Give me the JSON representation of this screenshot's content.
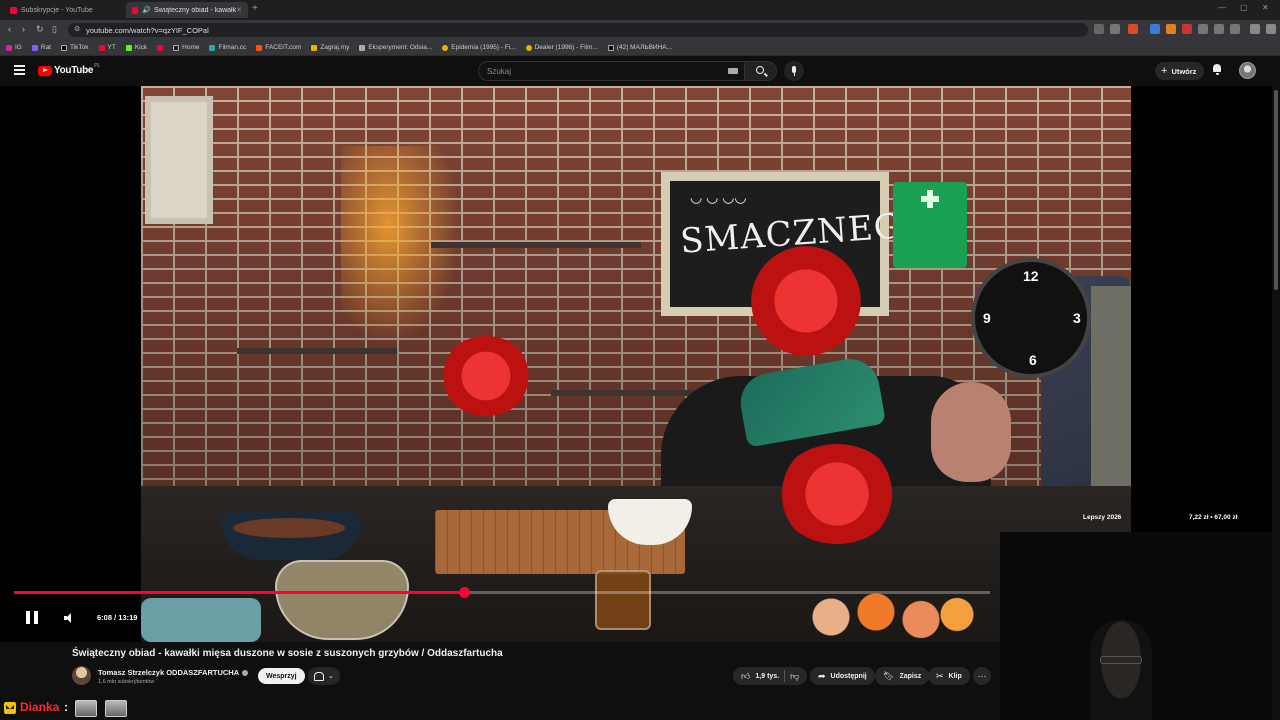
{
  "browser": {
    "tabs": [
      {
        "label": "Subskrypcje - YouTube",
        "active": false
      },
      {
        "label": "Świąteczny obiad - kawałki m",
        "active": true
      }
    ],
    "url": "youtube.com/watch?v=qzYIF_COPal",
    "bookmarks": [
      "IG",
      "Rat",
      "TikTok",
      "YT",
      "Kick",
      "Home",
      "Filman.cc",
      "FACEIT.com",
      "Zagraj.my",
      "Eksperyment: Odsia...",
      "Epidemia (1995) - Fi...",
      "Dealer (1996) - Film...",
      "(42) МАЛЬВИНА..."
    ]
  },
  "youtube": {
    "logo_text": "YouTube",
    "region": "PL",
    "search_placeholder": "Szukaj",
    "create_label": "Utwórz"
  },
  "player": {
    "current_time": "6:08",
    "duration": "13:19",
    "time_display": "6:08 / 13:19",
    "progress_fraction": 0.4606,
    "overlay_left": "Lepszy 2026",
    "overlay_right": "7,22 zł • 67,00 zł",
    "chalkboard_text": "SMACZNEGO"
  },
  "video": {
    "title": "Świąteczny obiad - kawałki mięsa duszone w sosie z suszonych grzybów / Oddaszfartucha",
    "channel": "Tomasz Strzelczyk ODDASZFARTUCHA",
    "subscribers": "1,6 mln subskrybentów",
    "join_label": "Wesprzyj",
    "likes": "1,9 tys.",
    "share_label": "Udostępnij",
    "save_label": "Zapisz",
    "clip_label": "Klip"
  },
  "stream_overlay": {
    "name": "Dianka",
    "separator": ":"
  },
  "colors": {
    "accent": "#ff0033",
    "background": "#0f0f0f",
    "stream_name": "#ff2a2a"
  }
}
